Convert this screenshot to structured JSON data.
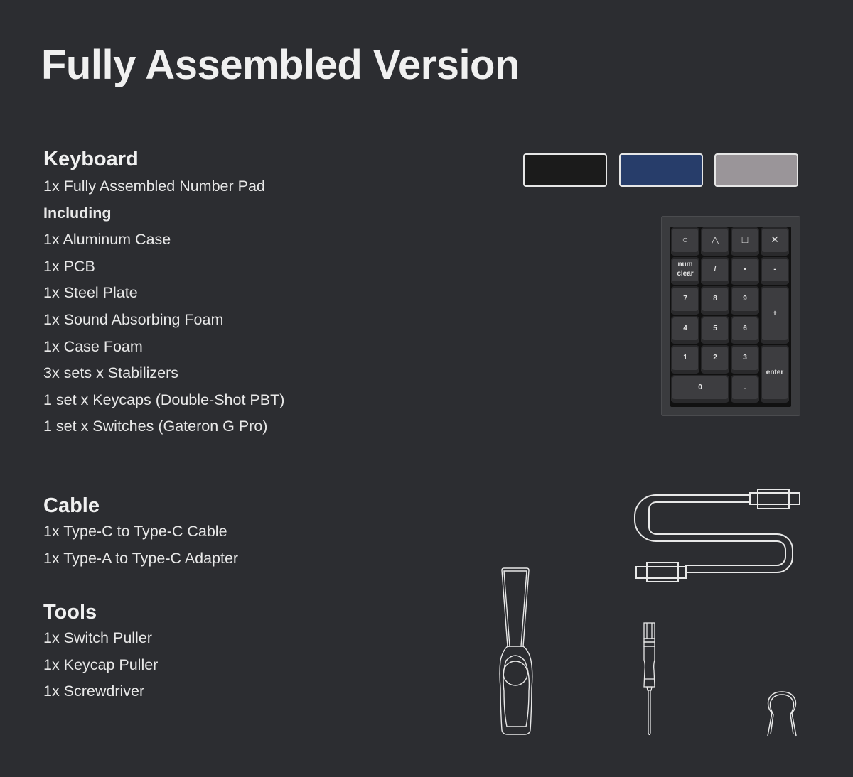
{
  "page": {
    "title": "Fully Assembled Version"
  },
  "sections": {
    "keyboard": {
      "heading": "Keyboard",
      "items": [
        {
          "text": "1x Fully Assembled Number Pad",
          "bold": false
        },
        {
          "text": "Including",
          "bold": true
        },
        {
          "text": "1x Aluminum Case",
          "bold": false
        },
        {
          "text": "1x PCB",
          "bold": false
        },
        {
          "text": "1x Steel Plate",
          "bold": false
        },
        {
          "text": "1x Sound Absorbing Foam",
          "bold": false
        },
        {
          "text": "1x Case Foam",
          "bold": false
        },
        {
          "text": "3x sets x Stabilizers",
          "bold": false
        },
        {
          "text": "1 set x Keycaps (Double-Shot PBT)",
          "bold": false
        },
        {
          "text": "1 set x Switches (Gateron G Pro)",
          "bold": false
        }
      ]
    },
    "cable": {
      "heading": "Cable",
      "items": [
        {
          "text": "1x Type-C to Type-C Cable",
          "bold": false
        },
        {
          "text": "1x Type-A to Type-C Adapter",
          "bold": false
        }
      ]
    },
    "tools": {
      "heading": "Tools",
      "items": [
        {
          "text": "1x Switch Puller",
          "bold": false
        },
        {
          "text": "1x Keycap Puller",
          "bold": false
        },
        {
          "text": "1x Screwdriver",
          "bold": false
        }
      ]
    }
  },
  "color_swatches": [
    {
      "name": "black",
      "color": "#1b1b1b"
    },
    {
      "name": "navy-blue",
      "color": "#273d6a"
    },
    {
      "name": "silver-grey",
      "color": "#9a9599"
    }
  ],
  "numpad": {
    "keys": [
      {
        "label": "○",
        "name": "key-circle",
        "symbol": true
      },
      {
        "label": "△",
        "name": "key-triangle",
        "symbol": true
      },
      {
        "label": "□",
        "name": "key-square",
        "symbol": true
      },
      {
        "label": "✕",
        "name": "key-cross",
        "symbol": true
      },
      {
        "label": "num\nclear",
        "name": "key-num-clear"
      },
      {
        "label": "/",
        "name": "key-divide"
      },
      {
        "label": "•",
        "name": "key-multiply"
      },
      {
        "label": "-",
        "name": "key-minus"
      },
      {
        "label": "7",
        "name": "key-7"
      },
      {
        "label": "8",
        "name": "key-8"
      },
      {
        "label": "9",
        "name": "key-9"
      },
      {
        "label": "+",
        "name": "key-plus"
      },
      {
        "label": "4",
        "name": "key-4"
      },
      {
        "label": "5",
        "name": "key-5"
      },
      {
        "label": "6",
        "name": "key-6"
      },
      {
        "label": "1",
        "name": "key-1"
      },
      {
        "label": "2",
        "name": "key-2"
      },
      {
        "label": "3",
        "name": "key-3"
      },
      {
        "label": "enter",
        "name": "key-enter"
      },
      {
        "label": "0",
        "name": "key-0"
      },
      {
        "label": ".",
        "name": "key-decimal"
      }
    ]
  },
  "illustrations": {
    "cable": "usb-c-cable-icon",
    "switch_puller": "switch-puller-icon",
    "screwdriver": "screwdriver-icon",
    "keycap_puller": "keycap-puller-icon"
  }
}
